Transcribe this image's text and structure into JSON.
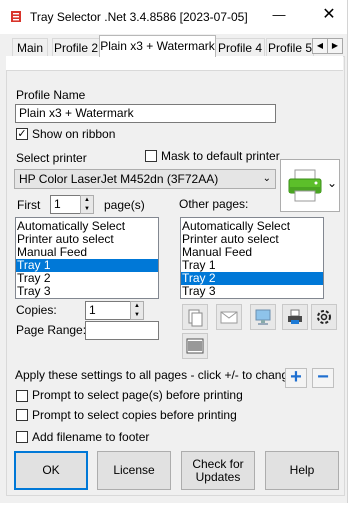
{
  "window": {
    "title": "Tray Selector .Net 3.4.8586 [2023-07-05]",
    "minimize": "—",
    "close": "✕"
  },
  "tabs": [
    "Main",
    "Profile 2",
    "Plain x3 + Watermark",
    "Profile 4",
    "Profile 5"
  ],
  "active_tab": "Plain x3 + Watermark",
  "tab_scroll": {
    "left": "◀",
    "right": "▶"
  },
  "profile": {
    "name_label": "Profile Name",
    "name_value": "Plain x3 + Watermark",
    "show_on_ribbon_label": "Show on ribbon",
    "show_on_ribbon_checked": true
  },
  "printer": {
    "select_label": "Select printer",
    "mask_label": "Mask to default printer",
    "mask_checked": false,
    "selected": "HP Color LaserJet M452dn (3F72AA)",
    "icon": "printer-icon"
  },
  "first": {
    "label": "First",
    "value": "1",
    "unit_label": "page(s)",
    "options": [
      "Automatically Select",
      "Printer auto select",
      "Manual Feed",
      "Tray 1",
      "Tray 2",
      "Tray 3"
    ],
    "selected": "Tray 1"
  },
  "other": {
    "label": "Other pages:",
    "options": [
      "Automatically Select",
      "Printer auto select",
      "Manual Feed",
      "Tray 1",
      "Tray 2",
      "Tray 3"
    ],
    "selected": "Tray 2"
  },
  "copies": {
    "label": "Copies:",
    "value": "1"
  },
  "page_range": {
    "label": "Page Range:",
    "value": ""
  },
  "tool_icons": [
    "copy-pages-icon",
    "envelope-icon",
    "monitor-icon",
    "printer-tray-icon",
    "gear-icon",
    "barcode-icon"
  ],
  "apply": {
    "label": "Apply these settings to all pages - click +/- to change",
    "plus": "+",
    "minus": "−"
  },
  "options": [
    {
      "label": "Prompt to select page(s) before printing",
      "checked": false
    },
    {
      "label": "Prompt to select copies before printing",
      "checked": false
    },
    {
      "label": "Add filename to footer",
      "checked": false
    }
  ],
  "buttons": {
    "ok": "OK",
    "license": "License",
    "check_updates": "Check for Updates",
    "help": "Help"
  },
  "colors": {
    "accent": "#0078d7",
    "selection": "#0078d7",
    "plus_minus": "#1f6fd0"
  }
}
